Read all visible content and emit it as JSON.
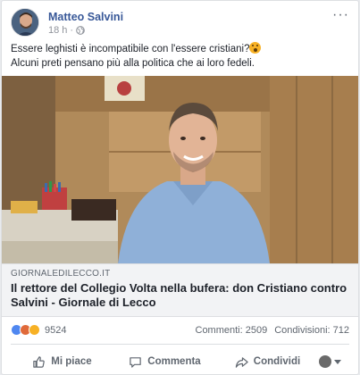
{
  "post": {
    "author": "Matteo Salvini",
    "time": "18 h",
    "privacy_icon": "globe-icon",
    "text_line1": "Essere leghisti è incompatibile con l'essere cristiani?",
    "text_line2": "Alcuni preti pensano più alla politica che ai loro fedeli.",
    "emoji": "wow-emoji"
  },
  "link": {
    "domain": "GIORNALEDILECCO.IT",
    "title": "Il rettore del Collegio Volta nella bufera: don Cristiano contro Salvini - Giornale di Lecco"
  },
  "stats": {
    "reaction_count": "9524",
    "comments": "Commenti: 2509",
    "shares": "Condivisioni: 712"
  },
  "actions": {
    "like": "Mi piace",
    "comment": "Commenta",
    "share": "Condividi"
  },
  "colors": {
    "link_blue": "#385898",
    "like_blue": "#4f87f0",
    "haha_yellow": "#f7b125",
    "angry_orange": "#e06a3a"
  }
}
